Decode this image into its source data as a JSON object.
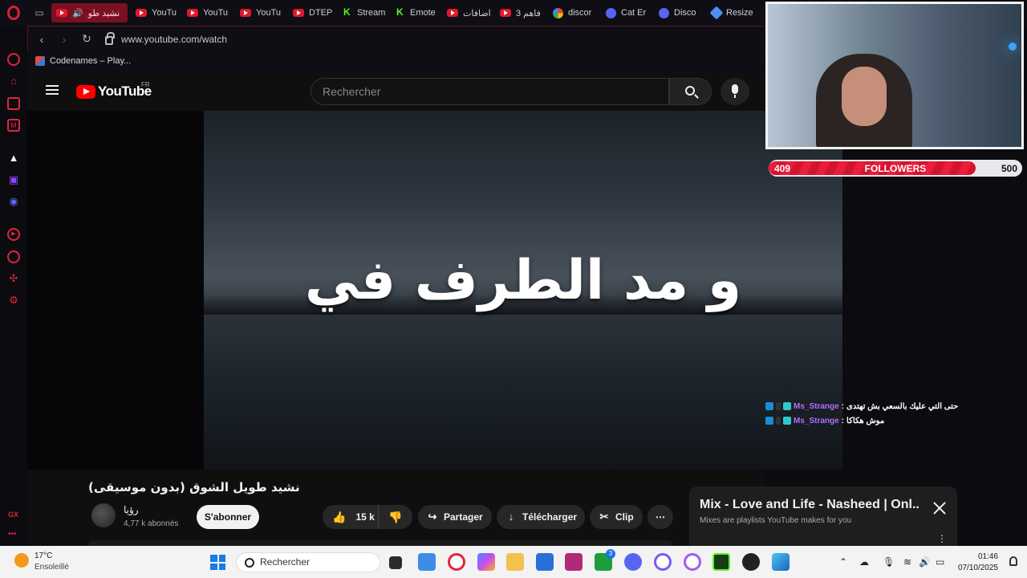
{
  "browser": {
    "tabs": [
      {
        "label": "نشيد طو",
        "active": true
      },
      {
        "label": "YouTu"
      },
      {
        "label": "YouTu"
      },
      {
        "label": "YouTu"
      },
      {
        "label": "DTEP"
      },
      {
        "label": "Stream"
      },
      {
        "label": "Emote"
      },
      {
        "label": "اضافات"
      },
      {
        "label": "فاهم 3"
      },
      {
        "label": "discor"
      },
      {
        "label": "Cat Er"
      },
      {
        "label": "Disco"
      },
      {
        "label": "Resize"
      }
    ],
    "url": "www.youtube.com/watch",
    "bookmark": "Codenames – Play..."
  },
  "youtube": {
    "logo": "YouTube",
    "region": "FR",
    "search_placeholder": "Rechercher",
    "video": {
      "lyric": "و مد الطرف في",
      "title": "نشيد طويل الشوق (بدون موسيقى)",
      "channel": "رؤيا",
      "subscribers": "4,77 k abonnés",
      "subscribe_label": "S'abonner",
      "likes": "15 k",
      "share_label": "Partager",
      "download_label": "Télécharger",
      "clip_label": "Clip",
      "more_label": "⋯"
    },
    "mix": {
      "title": "Mix - Love and Life - Nasheed | Onl...",
      "subtitle": "Mixes are playlists YouTube makes for you"
    }
  },
  "stream_overlay": {
    "followers_current": "409",
    "followers_label": "FOLLOWERS",
    "followers_goal": "500",
    "followers_progress": 0.818,
    "chat": [
      {
        "user": "Ms_Strange",
        "sep": ":",
        "message": "حتى التي عليك بالسعي بش تهتدى"
      },
      {
        "user": "Ms_Strange",
        "sep": ":",
        "message": "موش هكاكا"
      }
    ]
  },
  "sidebar": {
    "gx_label": "GX",
    "dots": "•••"
  },
  "taskbar": {
    "weather_temp": "17°C",
    "weather_cond": "Ensoleillé",
    "search_label": "Rechercher",
    "time": "01:46",
    "date": "07/10/2025",
    "xbox_badge": "3"
  },
  "colors": {
    "accent": "#e2243f",
    "youtube_red": "#ff0000",
    "chat_user": "#b46cff"
  }
}
